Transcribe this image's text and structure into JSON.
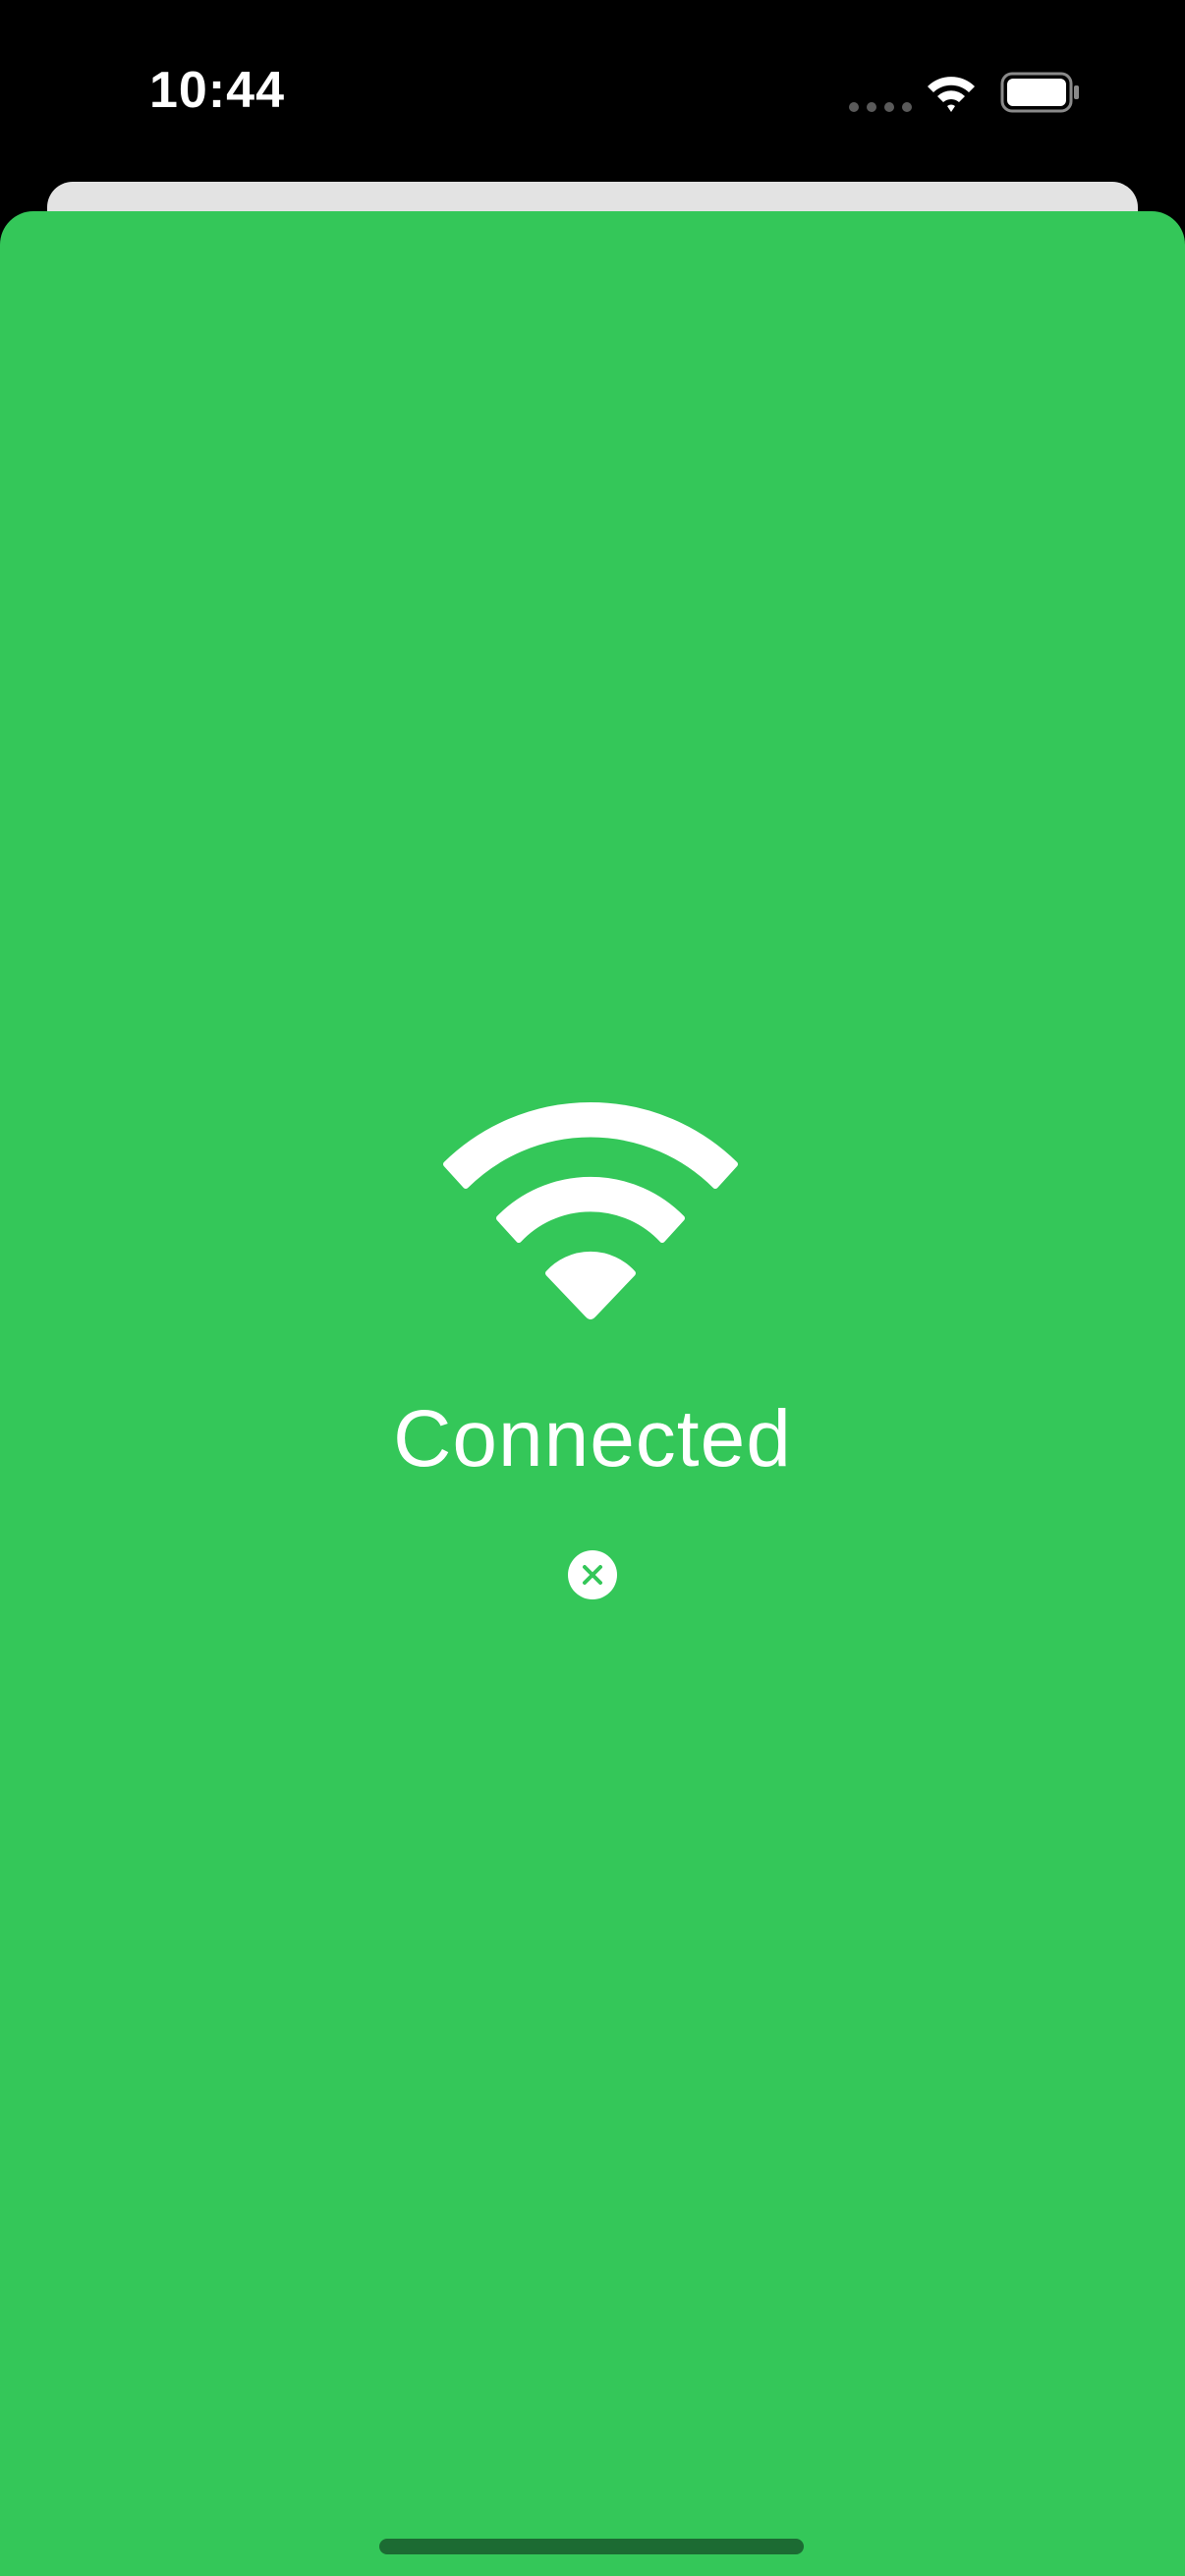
{
  "status_bar": {
    "time": "10:44",
    "wifi_icon": "wifi-icon",
    "battery_icon": "battery-icon"
  },
  "main": {
    "icon": "wifi-icon",
    "status_text": "Connected",
    "close_icon": "close-circle-icon"
  },
  "colors": {
    "background": "#34c759",
    "foreground": "#ffffff",
    "status_bar": "#000000"
  }
}
